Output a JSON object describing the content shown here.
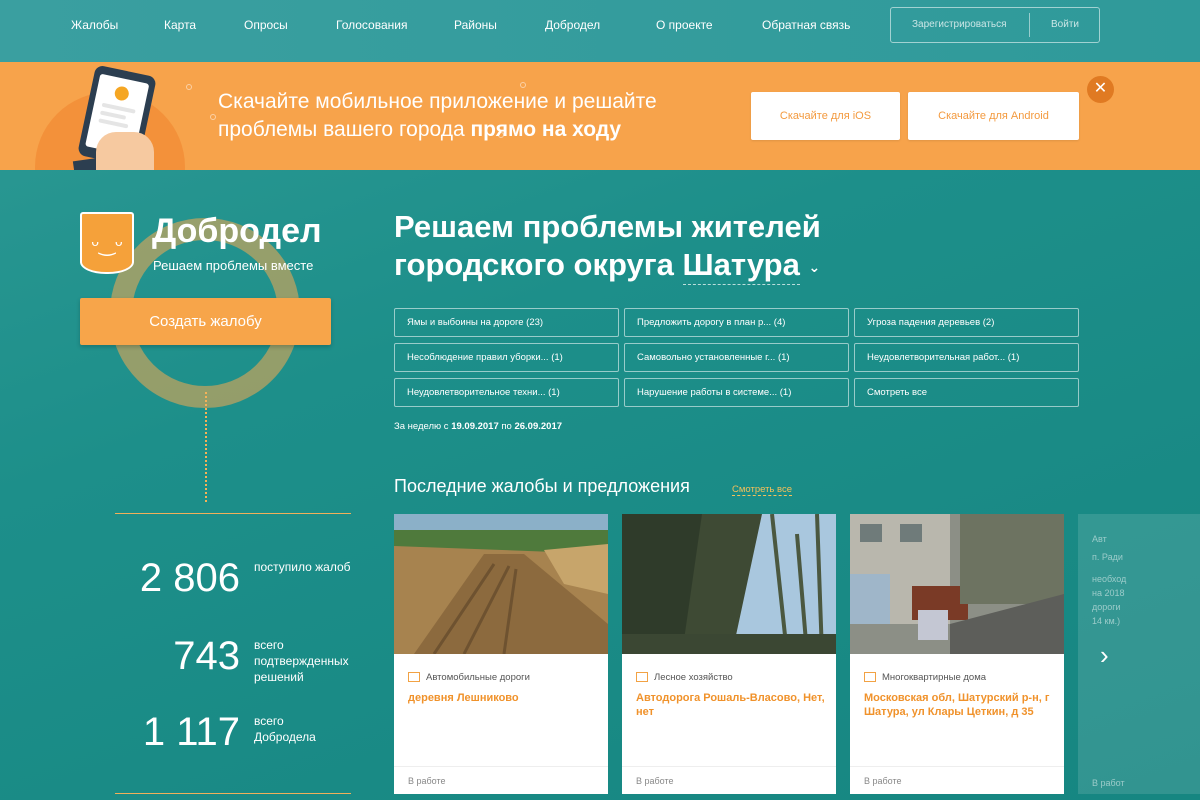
{
  "nav": {
    "items": [
      {
        "label": "Жалобы"
      },
      {
        "label": "Карта"
      },
      {
        "label": "Опросы"
      },
      {
        "label": "Голосования"
      },
      {
        "label": "Районы"
      },
      {
        "label": "Добродел"
      },
      {
        "label": "О проекте"
      },
      {
        "label": "Обратная связь"
      }
    ],
    "register_label": "Зарегистрироваться",
    "login_label": "Войти"
  },
  "banner": {
    "line1": "Скачайте мобильное приложение и решайте",
    "line2_normal": "проблемы вашего города ",
    "line2_bold": "прямо на ходу",
    "ios_label": "Скачайте для iOS",
    "android_label": "Скачайте для Android",
    "close_label": "✕"
  },
  "brand": {
    "title": "Добродел",
    "subtitle": "Решаем проблемы вместе",
    "face": "ᵕ‿ᵕ",
    "create_label": "Создать жалобу"
  },
  "stats": [
    {
      "value": "2 806",
      "label": "поступило жалоб"
    },
    {
      "value": "743",
      "label": "всего подтвержденных решений"
    },
    {
      "value": "1 117",
      "label": "всего Добродела"
    }
  ],
  "headline": {
    "line1": "Решаем проблемы жителей",
    "line2": "городского округа ",
    "city": "Шатура",
    "chevron": "⌄"
  },
  "tags": [
    {
      "label": "Ямы и выбоины на дороге (23)"
    },
    {
      "label": "Предложить дорогу в план р... (4)"
    },
    {
      "label": "Угроза падения деревьев (2)"
    },
    {
      "label": "Несоблюдение правил уборки... (1)"
    },
    {
      "label": "Самовольно установленные г... (1)"
    },
    {
      "label": "Неудовлетворительная работ... (1)"
    },
    {
      "label": "Неудовлетворительное техни... (1)"
    },
    {
      "label": "Нарушение работы в системе... (1)"
    },
    {
      "label": "Смотреть все"
    }
  ],
  "week": {
    "prefix": "За неделю с ",
    "from": "19.09.2017",
    "mid": " по ",
    "to": "26.09.2017"
  },
  "latest": {
    "title": "Последние жалобы и предложения",
    "see_all": "Смотреть все",
    "cards": [
      {
        "category": "Автомобильные дороги",
        "title": "деревня Лешниково",
        "status": "В работе"
      },
      {
        "category": "Лесное хозяйство",
        "title": "Автодорога Рошаль-Власово, Нет, нет",
        "status": "В работе"
      },
      {
        "category": "Многоквартирные дома",
        "title": "Московская обл, Шатурский р-н, г Шатура, ул Клары Цеткин, д 35",
        "status": "В работе"
      }
    ],
    "ghost": {
      "category": "Авт",
      "title": "п. Ради",
      "body": [
        "необход",
        "на 2018",
        "дороги",
        "14 км.)"
      ],
      "status": "В работ"
    },
    "next": "›"
  }
}
